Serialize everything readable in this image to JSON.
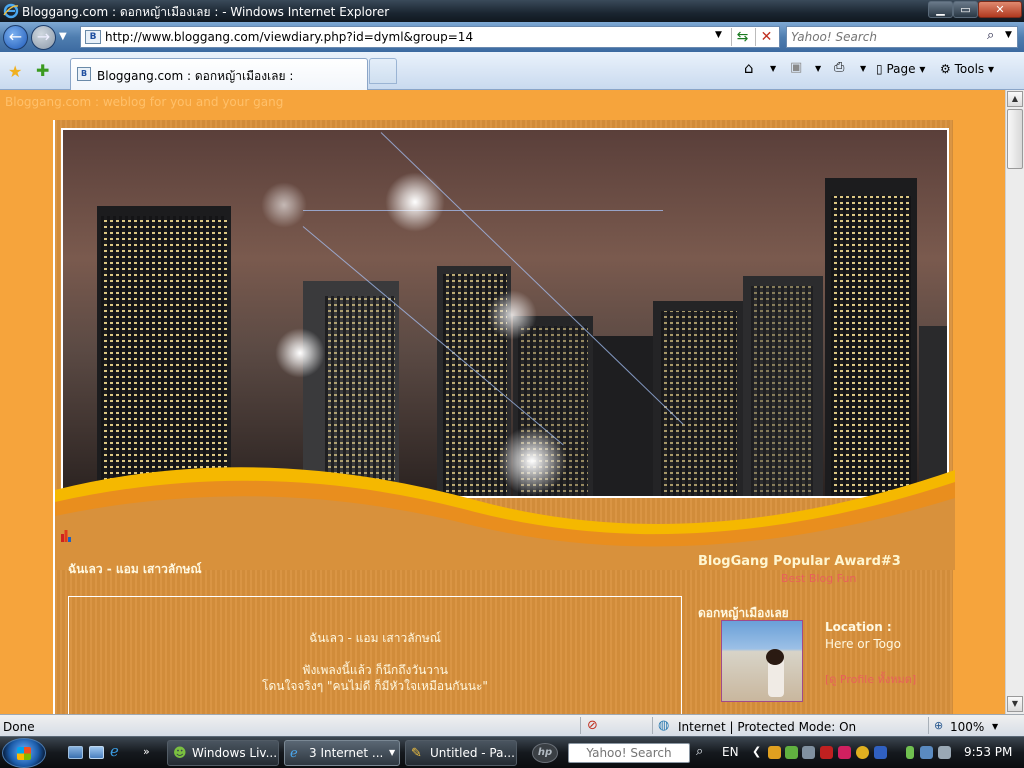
{
  "window": {
    "title": "Bloggang.com : ดอกหญ้าเมืองเลย : - Windows Internet Explorer",
    "minimize_label": "▁",
    "maximize_label": "▭",
    "close_label": "✕"
  },
  "address_bar": {
    "url": "http://www.bloggang.com/viewdiary.php?id=dyml&group=14",
    "search_placeholder": "Yahoo! Search"
  },
  "tabs": [
    {
      "label": "Bloggang.com : ดอกหญ้าเมืองเลย :"
    }
  ],
  "command_bar": {
    "page_label": "Page",
    "tools_label": "Tools"
  },
  "page": {
    "tagline": "Bloggang.com : weblog for you and your gang",
    "song_heading": "ฉันเลว - แอม เสาวลักษณ์",
    "post_lines": [
      "ฉันเลว - แอม เสาวลักษณ์",
      "ฟังเพลงนี้แล้ว ก็นึกถึงวันวาน",
      "โดนใจจริงๆ \"คนไม่ดี ก็มีหัวใจเหมือนกันนะ\""
    ],
    "award_title": "BlogGang Popular Award#3",
    "award_link": "Best Blog Fun",
    "sidebar_name": "ดอกหญ้าเมืองเลย",
    "location_label": "Location :",
    "location_value": "Here or Togo",
    "profile_link": "[ดู Profile ทั้งหมด]"
  },
  "statusbar": {
    "status": "Done",
    "zone": "Internet | Protected Mode: On",
    "zoom": "100%"
  },
  "taskbar": {
    "tasks": [
      {
        "label": "Windows Liv...",
        "icon": "people-icon"
      },
      {
        "label": "3 Internet ...",
        "icon": "ie-icon"
      },
      {
        "label": "Untitled - Pa...",
        "icon": "paint-icon"
      }
    ],
    "search_placeholder": "Yahoo! Search",
    "language": "EN",
    "clock": "9:53 PM"
  },
  "colors": {
    "page_bg": "#f6a43c",
    "frame_bg": "#d8913c",
    "link_red": "#e8605a",
    "text_cream": "#fff8e0"
  }
}
